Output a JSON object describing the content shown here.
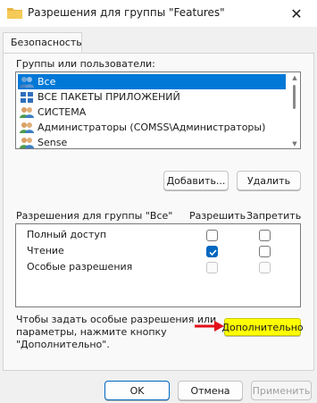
{
  "window": {
    "title": "Разрешения для группы \"Features\"",
    "close_glyph": "✕"
  },
  "tab": {
    "label": "Безопасность"
  },
  "groups": {
    "label": "Группы или пользователи:",
    "items": [
      {
        "name": "Все",
        "icon": "users-icon",
        "selected": true
      },
      {
        "name": "ВСЕ ПАКЕТЫ ПРИЛОЖЕНИЙ",
        "icon": "app-packages-icon",
        "selected": false
      },
      {
        "name": "СИСТЕМА",
        "icon": "users-icon",
        "selected": false
      },
      {
        "name": "Администраторы (COMSS\\Администраторы)",
        "icon": "users-icon",
        "selected": false
      },
      {
        "name": "Sense",
        "icon": "users-icon",
        "selected": false
      }
    ]
  },
  "buttons": {
    "add": "Добавить...",
    "remove": "Удалить",
    "advanced": "Дополнительно",
    "ok": "OK",
    "cancel": "Отмена",
    "apply": "Применить"
  },
  "permissions": {
    "header": "Разрешения для группы \"Все\"",
    "allow_header": "Разрешить",
    "deny_header": "Запретить",
    "rows": [
      {
        "name": "Полный доступ",
        "allow": false,
        "deny": false,
        "disabled": false
      },
      {
        "name": "Чтение",
        "allow": true,
        "deny": false,
        "disabled": false
      },
      {
        "name": "Особые разрешения",
        "allow": false,
        "deny": false,
        "disabled": true
      }
    ]
  },
  "advanced_hint": {
    "line1": "Чтобы задать особые разрешения или",
    "line2": "параметры, нажмите кнопку",
    "line3": "\"Дополнительно\"."
  },
  "colors": {
    "selection": "#0078d7",
    "accent": "#0067c0",
    "highlight": "#ffff00",
    "arrow": "#e3101a"
  }
}
